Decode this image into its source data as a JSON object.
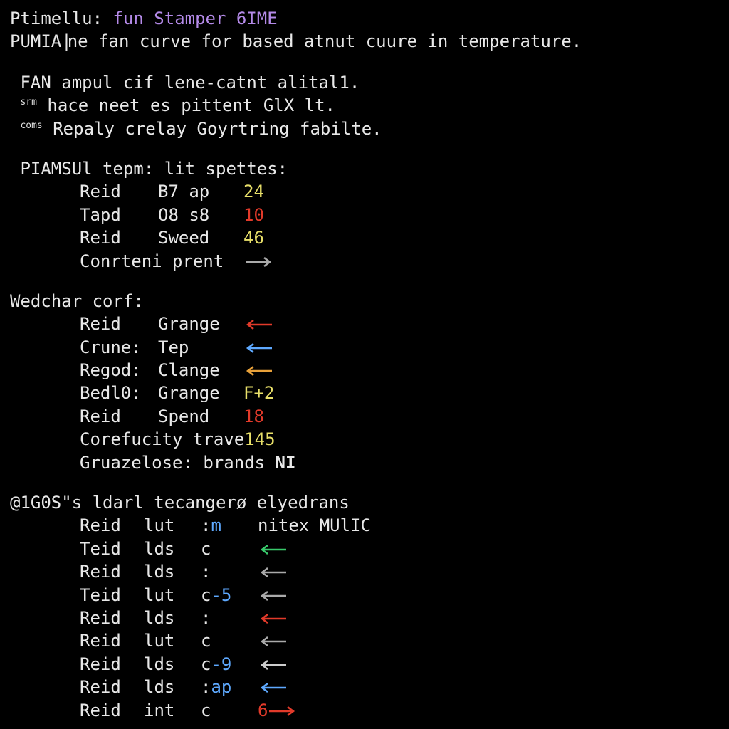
{
  "header": {
    "prompt1_label": "Ptimellu:",
    "prompt1_cmd": "fun Stamper 6IME",
    "prompt2_label": "PUMIA",
    "prompt2_rest": "ne fan curve for based atnut cuure in temperature."
  },
  "intro": {
    "line1": "FAN ampul cif lene-catnt alital1.",
    "sup2": "srm",
    "line2": " hace neet es pittent GlX lt.",
    "sup3": "coms",
    "line3": " Repaly crelay Goyrtring fabilte."
  },
  "section1": {
    "title": "PIAMSUl tepm: lit spettes:",
    "rows": [
      {
        "c1": "Reid",
        "c2": "B7 ap",
        "val": "24",
        "val_color": "c-yellow"
      },
      {
        "c1": "Tapd",
        "c2": "O8 s8",
        "val": "10",
        "val_color": "c-red"
      },
      {
        "c1": "Reid",
        "c2": "Sweed",
        "val": "46",
        "val_color": "c-yellow"
      }
    ],
    "footer": {
      "label": "Conrteni prent",
      "arrow": "right",
      "arrow_color": "#aaa"
    }
  },
  "section2": {
    "title": "Wedchar corf:",
    "rows": [
      {
        "c1": "Reid",
        "c2": "Grange",
        "arrow": "left",
        "arrow_color": "#e23a2a"
      },
      {
        "c1": "Crune:",
        "c2": "Tep",
        "arrow": "left",
        "arrow_color": "#5ea9ff"
      },
      {
        "c1": "Regod:",
        "c2": "Clange",
        "arrow": "left",
        "arrow_color": "#e8a13a"
      },
      {
        "c1": "Bedl0:",
        "c2": "Grange",
        "val": "F+2",
        "val_color": "c-yellow"
      },
      {
        "c1": "Reid",
        "c2": "Spend",
        "val": "18",
        "val_color": "c-red"
      }
    ],
    "extra1": {
      "label": "Corefucity trave",
      "val": "145",
      "val_color": "c-yellow"
    },
    "extra2": {
      "label": "Gruazelose: brands ",
      "val": "NI"
    }
  },
  "section3": {
    "title": "@1G0S\"s ldarl tecangerø elyedrans",
    "head": {
      "c1": "Reid",
      "c2": "lut",
      "c3a": ":",
      "c3b": "m",
      "c4": "nitex MUlIC"
    },
    "rows": [
      {
        "c1": "Teid",
        "c2": "lds",
        "c3": "c",
        "arrow": "left",
        "arrow_color": "#38c96b"
      },
      {
        "c1": "Reid",
        "c2": "lds",
        "c3": ":",
        "arrow": "left",
        "arrow_color": "#aaa"
      },
      {
        "c1": "Teid",
        "c2": "lut",
        "c3": "c",
        "c3_ext": "-5",
        "arrow": "left",
        "arrow_color": "#aaa"
      },
      {
        "c1": "Reid",
        "c2": "lds",
        "c3": ":",
        "arrow": "left",
        "arrow_color": "#e23a2a"
      },
      {
        "c1": "Reid",
        "c2": "lut",
        "c3": "c",
        "arrow": "left",
        "arrow_color": "#aaa"
      },
      {
        "c1": "Reid",
        "c2": "lds",
        "c3": "c",
        "c3_ext": "-9",
        "arrow": "left",
        "arrow_color": "#ccc"
      },
      {
        "c1": "Reid",
        "c2": "lds",
        "c3": ":",
        "c3_ext": "ap",
        "arrow": "left",
        "arrow_color": "#5ea9ff"
      },
      {
        "c1": "Reid",
        "c2": "int",
        "c3": "c",
        "val": "6",
        "val_color": "c-red",
        "arrow": "right",
        "arrow_color": "#e23a2a"
      }
    ]
  },
  "colors": {
    "yellow": "#e9e06a",
    "red": "#e23a2a",
    "green": "#38c96b",
    "blue": "#5ea9ff",
    "orange": "#e8a13a",
    "grey": "#aaa",
    "purple": "#b48ae8"
  }
}
